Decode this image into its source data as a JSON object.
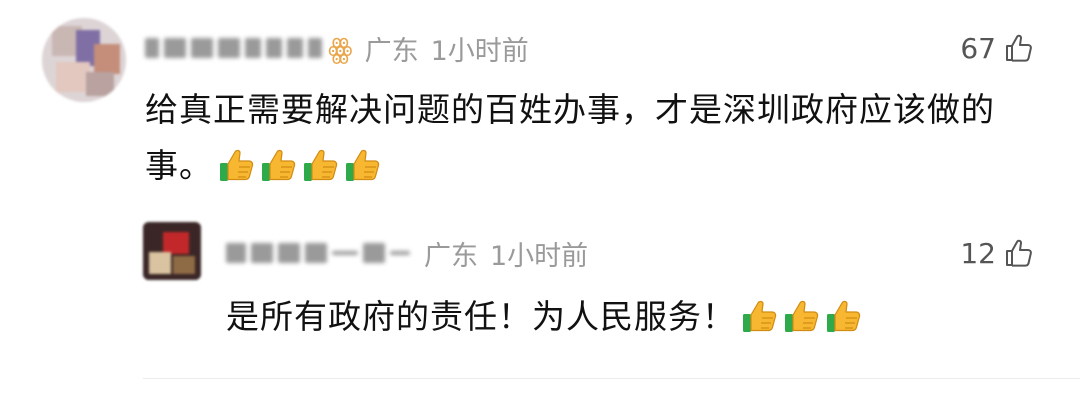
{
  "comment": {
    "location": "广东",
    "time": "1小时前",
    "likes": "67",
    "text": "给真正需要解决问题的百姓办事，才是深圳政府应该做的事。",
    "emoji_icon": "thumbs-up-emoji",
    "emoji_count": 4,
    "username_suffix": "ꙮ"
  },
  "reply": {
    "location": "广东",
    "time": "1小时前",
    "likes": "12",
    "text": "是所有政府的责任！为人民服务！",
    "emoji_icon": "thumbs-up-emoji",
    "emoji_count": 3
  },
  "colors": {
    "meta_gray": "#9a9a9a",
    "text": "#111111",
    "divider": "#ececec"
  },
  "icons": {
    "like": "thumbs-up-outline-icon"
  }
}
